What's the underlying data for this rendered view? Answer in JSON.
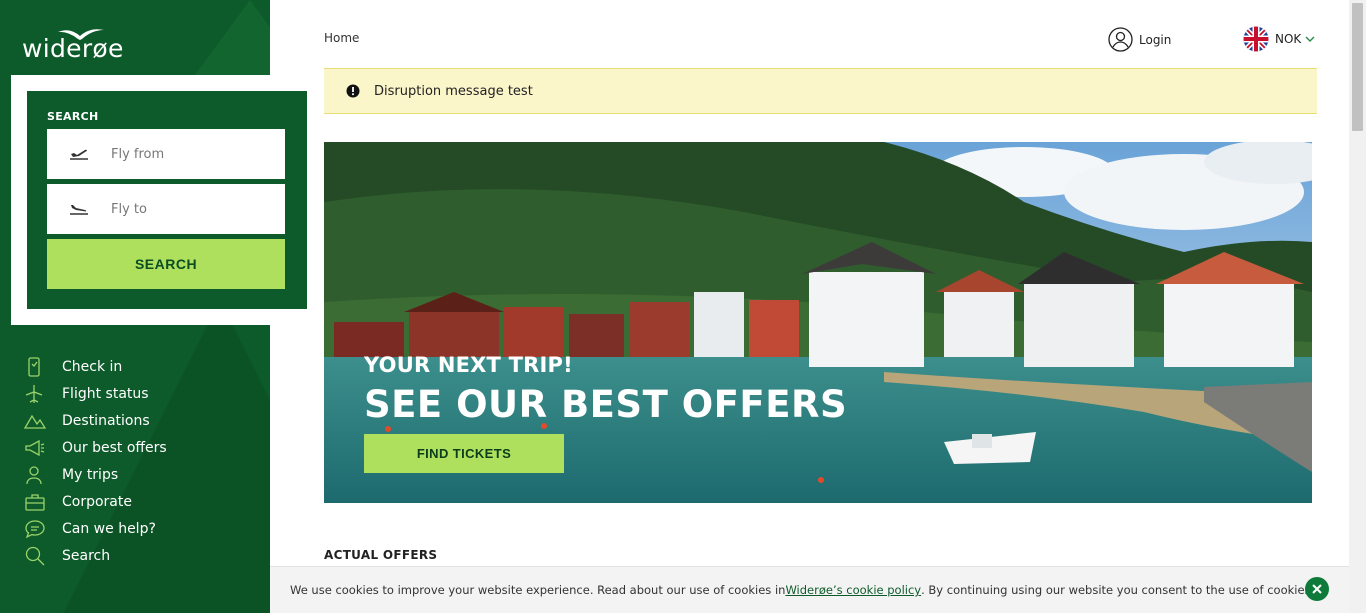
{
  "brand": {
    "name": "widerøe"
  },
  "search": {
    "title": "SEARCH",
    "from_placeholder": "Fly from",
    "to_placeholder": "Fly to",
    "button": "SEARCH"
  },
  "nav": [
    {
      "label": "Check in",
      "icon": "phone-icon"
    },
    {
      "label": "Flight status",
      "icon": "plane-icon"
    },
    {
      "label": "Destinations",
      "icon": "mountain-icon"
    },
    {
      "label": "Our best offers",
      "icon": "megaphone-icon"
    },
    {
      "label": "My trips",
      "icon": "user-icon"
    },
    {
      "label": "Corporate",
      "icon": "briefcase-icon"
    },
    {
      "label": "Can we help?",
      "icon": "chat-icon"
    },
    {
      "label": "Search",
      "icon": "search-icon"
    }
  ],
  "header": {
    "breadcrumb": "Home",
    "login": "Login",
    "currency": "NOK"
  },
  "alert": {
    "text": "Disruption message test"
  },
  "hero": {
    "subtitle": "YOUR NEXT TRIP!",
    "title": "SEE OUR BEST OFFERS",
    "button": "FIND TICKETS"
  },
  "offers": {
    "heading": "ACTUAL OFFERS"
  },
  "cookie": {
    "text_before": "We use cookies to improve your website experience. Read about our use of cookies in ",
    "link": "Widerøe’s cookie policy",
    "text_after": ". By continuing using our website you consent to the use of cookies."
  },
  "colors": {
    "brand_green": "#0d5b2a",
    "accent_lime": "#aee05e",
    "alert_bg": "#fbf6c9"
  }
}
